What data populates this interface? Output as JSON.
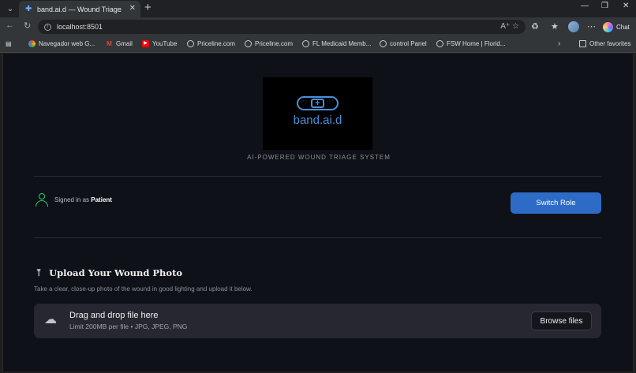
{
  "browser": {
    "tab_title": "band.ai.d — Wound Triage",
    "url": "localhost:8501",
    "chat_label": "Chat",
    "bookmarks": [
      {
        "label": "Navegador web G...",
        "icon": "chrome-icon"
      },
      {
        "label": "Gmail",
        "icon": "gmail-icon"
      },
      {
        "label": "YouTube",
        "icon": "youtube-icon"
      },
      {
        "label": "Priceline.com",
        "icon": "globe-icon"
      },
      {
        "label": "Priceline.com",
        "icon": "globe-icon"
      },
      {
        "label": "FL Medicaid Memb...",
        "icon": "globe-icon"
      },
      {
        "label": "control Panel",
        "icon": "globe-icon"
      },
      {
        "label": "FSW Home | Florid...",
        "icon": "globe-icon"
      }
    ],
    "other_favorites": "Other favorites"
  },
  "app": {
    "logo_text": "band.ai.d",
    "tagline": "AI-POWERED WOUND TRIAGE SYSTEM",
    "signed_in_prefix": "Signed in as",
    "role": "Patient",
    "switch_role_label": "Switch Role",
    "upload": {
      "title": "Upload Your Wound Photo",
      "description": "Take a clear, close-up photo of the wound in good lighting and upload it below.",
      "drop_title": "Drag and drop file here",
      "drop_limit": "Limit 200MB per file • JPG, JPEG, PNG",
      "browse_label": "Browse files"
    }
  },
  "colors": {
    "accent": "#2e6bc6",
    "logo_blue": "#4a90d9",
    "user_icon_green": "#2ecc71",
    "background": "#0e1117"
  }
}
